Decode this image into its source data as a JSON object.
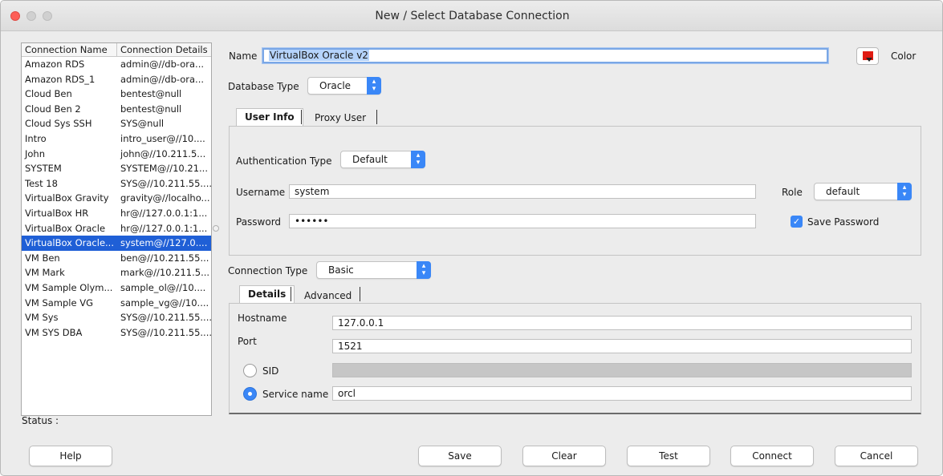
{
  "window": {
    "title": "New / Select Database Connection"
  },
  "connections": {
    "headers": {
      "name": "Connection Name",
      "details": "Connection Details"
    },
    "rows": [
      {
        "name": "Amazon RDS",
        "details": "admin@//db-ora..."
      },
      {
        "name": "Amazon RDS_1",
        "details": "admin@//db-ora..."
      },
      {
        "name": "Cloud Ben",
        "details": "bentest@null"
      },
      {
        "name": "Cloud Ben 2",
        "details": "bentest@null"
      },
      {
        "name": "Cloud Sys SSH",
        "details": "SYS@null"
      },
      {
        "name": "Intro",
        "details": "intro_user@//10...."
      },
      {
        "name": "John",
        "details": "john@//10.211.5..."
      },
      {
        "name": "SYSTEM",
        "details": "SYSTEM@//10.21..."
      },
      {
        "name": "Test 18",
        "details": "SYS@//10.211.55...."
      },
      {
        "name": "VirtualBox Gravity",
        "details": "gravity@//localho..."
      },
      {
        "name": "VirtualBox HR",
        "details": "hr@//127.0.0.1:1..."
      },
      {
        "name": "VirtualBox Oracle",
        "details": "hr@//127.0.0.1:1..."
      },
      {
        "name": "VirtualBox Oracle...",
        "details": "system@//127.0...."
      },
      {
        "name": "VM Ben",
        "details": "ben@//10.211.55..."
      },
      {
        "name": "VM Mark",
        "details": "mark@//10.211.5..."
      },
      {
        "name": "VM Sample Olym...",
        "details": "sample_ol@//10...."
      },
      {
        "name": "VM Sample VG",
        "details": "sample_vg@//10...."
      },
      {
        "name": "VM Sys",
        "details": "SYS@//10.211.55...."
      },
      {
        "name": "VM SYS DBA",
        "details": "SYS@//10.211.55...."
      }
    ],
    "selected_index": 12
  },
  "status": {
    "label": "Status :"
  },
  "form": {
    "name_label": "Name",
    "name_value": "VirtualBox Oracle v2",
    "color_label": "Color",
    "color_value": "#e01b12",
    "db_type_label": "Database Type",
    "db_type_value": "Oracle",
    "tabs_user": [
      "User Info",
      "Proxy User"
    ],
    "auth_type_label": "Authentication Type",
    "auth_type_value": "Default",
    "username_label": "Username",
    "username_value": "system",
    "password_label": "Password",
    "password_value": "••••••",
    "role_label": "Role",
    "role_value": "default",
    "save_password_label": "Save Password",
    "save_password_checked": true,
    "conn_type_label": "Connection Type",
    "conn_type_value": "Basic",
    "tabs_conn": [
      "Details",
      "Advanced"
    ],
    "hostname_label": "Hostname",
    "hostname_value": "127.0.0.1",
    "port_label": "Port",
    "port_value": "1521",
    "sid_label": "SID",
    "service_name_label": "Service name",
    "service_name_value": "orcl",
    "selected_option": "Service name"
  },
  "buttons": {
    "help": "Help",
    "save": "Save",
    "clear": "Clear",
    "test": "Test",
    "connect": "Connect",
    "cancel": "Cancel"
  }
}
